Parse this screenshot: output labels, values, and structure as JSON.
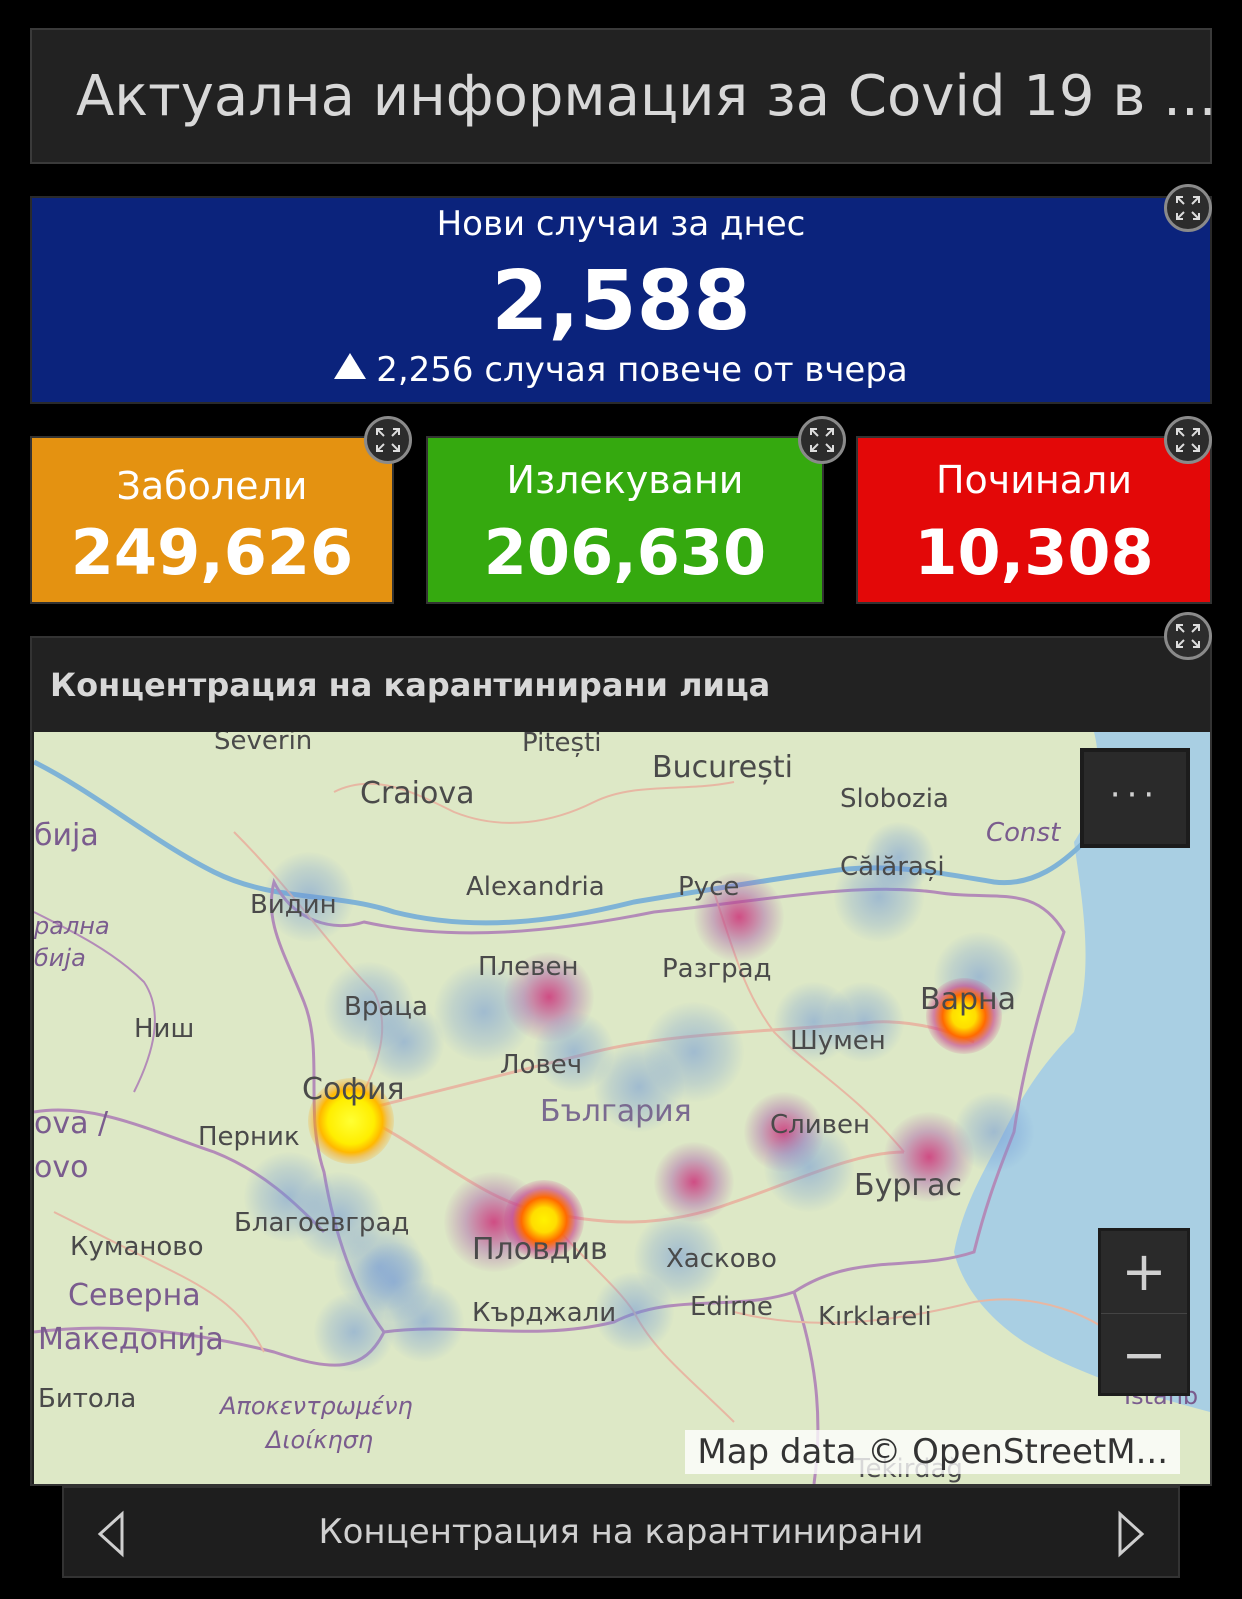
{
  "title": "Актуална информация за Covid 19 в ...",
  "new_cases": {
    "label": "Нови случаи за днес",
    "value": "2,588",
    "trend_icon": "triangle-up-icon",
    "delta_text": "2,256 случая повече от вчера"
  },
  "stats": {
    "confirmed": {
      "label": "Заболели",
      "value": "249,626",
      "color": "#e49211"
    },
    "recovered": {
      "label": "Излекувани",
      "value": "206,630",
      "color": "#35a90f"
    },
    "deaths": {
      "label": "Починали",
      "value": "10,308",
      "color": "#e30808"
    }
  },
  "map": {
    "title": "Концентрация на карантинирани лица",
    "more_label": "···",
    "zoom_in": "+",
    "zoom_out": "−",
    "attribution": "Map data © OpenStreetM...",
    "labels": {
      "severin": "Severin",
      "pitesti": "Pitești",
      "bucuresti": "București",
      "craiova": "Craiova",
      "slobozia": "Slobozia",
      "const": "Const",
      "srbija": "бија",
      "calarasi": "Călărași",
      "alexandria": "Alexandria",
      "ruse": "Русе",
      "vidin": "Видин",
      "centralna": "ралнa",
      "srbija2": "бија",
      "pleven": "Плевен",
      "razgrad": "Разград",
      "varna": "Варна",
      "vratsa": "Враца",
      "nish": "Ниш",
      "shumen": "Шумен",
      "lovech": "Ловеч",
      "sofia": "София",
      "bulgaria": "България",
      "sliven": "Сливен",
      "kosova": "ova /",
      "ovo": "ovo",
      "pernik": "Перник",
      "burgas": "Бургас",
      "blagoevgrad": "Благоевград",
      "kumanovo": "Куманово",
      "plovdiv": "Пловдив",
      "haskovo": "Хасково",
      "severna": "Северна",
      "makedonija": "Македонија",
      "kardzhali": "Кърджали",
      "edirne": "Edirne",
      "kirklareli": "Kırklareli",
      "bitola": "Битола",
      "apokentr": "Αποκεντρωμένη",
      "dioikisi": "Διοίκηση",
      "istanbul": "İstanb",
      "tekirdag": "Tekirdağ"
    }
  },
  "carousel": {
    "caption": "Концентрация на карантинирани",
    "prev_icon": "chevron-left-icon",
    "next_icon": "chevron-right-icon"
  },
  "colors": {
    "background": "#000000",
    "new_cases_bg": "#0b237c"
  }
}
